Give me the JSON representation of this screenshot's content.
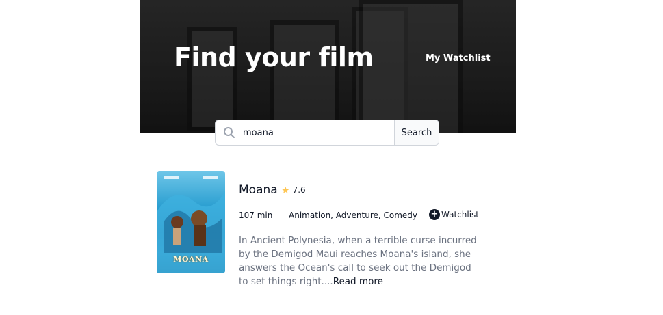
{
  "header": {
    "title": "Find your film",
    "watchlist_link": "My Watchlist"
  },
  "search": {
    "value": "moana",
    "button_label": "Search",
    "icon": "search-icon"
  },
  "results": [
    {
      "title": "Moana",
      "rating": "7.6",
      "runtime": "107 min",
      "genres": "Animation, Adventure, Comedy",
      "watchlist_label": "Watchlist",
      "poster_text": "MOANA",
      "plot": "In Ancient Polynesia, when a terrible curse incurred by the Demigod Maui reaches Moana's island, she answers the Ocean's call to seek out the Demigod to set things right....",
      "read_more": "Read more"
    }
  ],
  "colors": {
    "star": "#fec654",
    "text": "#111827",
    "muted": "#6b7280",
    "border": "#d1d5db"
  }
}
